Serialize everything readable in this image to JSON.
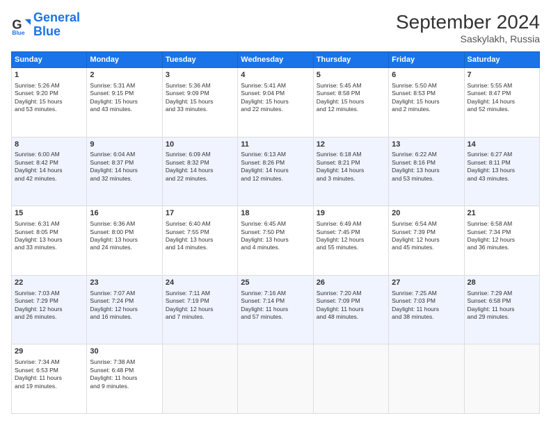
{
  "logo": {
    "line1": "General",
    "line2": "Blue"
  },
  "title": "September 2024",
  "subtitle": "Saskylakh, Russia",
  "headers": [
    "Sunday",
    "Monday",
    "Tuesday",
    "Wednesday",
    "Thursday",
    "Friday",
    "Saturday"
  ],
  "weeks": [
    [
      {
        "day": 1,
        "lines": [
          "Sunrise: 5:26 AM",
          "Sunset: 9:20 PM",
          "Daylight: 15 hours",
          "and 53 minutes."
        ]
      },
      {
        "day": 2,
        "lines": [
          "Sunrise: 5:31 AM",
          "Sunset: 9:15 PM",
          "Daylight: 15 hours",
          "and 43 minutes."
        ]
      },
      {
        "day": 3,
        "lines": [
          "Sunrise: 5:36 AM",
          "Sunset: 9:09 PM",
          "Daylight: 15 hours",
          "and 33 minutes."
        ]
      },
      {
        "day": 4,
        "lines": [
          "Sunrise: 5:41 AM",
          "Sunset: 9:04 PM",
          "Daylight: 15 hours",
          "and 22 minutes."
        ]
      },
      {
        "day": 5,
        "lines": [
          "Sunrise: 5:45 AM",
          "Sunset: 8:58 PM",
          "Daylight: 15 hours",
          "and 12 minutes."
        ]
      },
      {
        "day": 6,
        "lines": [
          "Sunrise: 5:50 AM",
          "Sunset: 8:53 PM",
          "Daylight: 15 hours",
          "and 2 minutes."
        ]
      },
      {
        "day": 7,
        "lines": [
          "Sunrise: 5:55 AM",
          "Sunset: 8:47 PM",
          "Daylight: 14 hours",
          "and 52 minutes."
        ]
      }
    ],
    [
      {
        "day": 8,
        "lines": [
          "Sunrise: 6:00 AM",
          "Sunset: 8:42 PM",
          "Daylight: 14 hours",
          "and 42 minutes."
        ]
      },
      {
        "day": 9,
        "lines": [
          "Sunrise: 6:04 AM",
          "Sunset: 8:37 PM",
          "Daylight: 14 hours",
          "and 32 minutes."
        ]
      },
      {
        "day": 10,
        "lines": [
          "Sunrise: 6:09 AM",
          "Sunset: 8:32 PM",
          "Daylight: 14 hours",
          "and 22 minutes."
        ]
      },
      {
        "day": 11,
        "lines": [
          "Sunrise: 6:13 AM",
          "Sunset: 8:26 PM",
          "Daylight: 14 hours",
          "and 12 minutes."
        ]
      },
      {
        "day": 12,
        "lines": [
          "Sunrise: 6:18 AM",
          "Sunset: 8:21 PM",
          "Daylight: 14 hours",
          "and 3 minutes."
        ]
      },
      {
        "day": 13,
        "lines": [
          "Sunrise: 6:22 AM",
          "Sunset: 8:16 PM",
          "Daylight: 13 hours",
          "and 53 minutes."
        ]
      },
      {
        "day": 14,
        "lines": [
          "Sunrise: 6:27 AM",
          "Sunset: 8:11 PM",
          "Daylight: 13 hours",
          "and 43 minutes."
        ]
      }
    ],
    [
      {
        "day": 15,
        "lines": [
          "Sunrise: 6:31 AM",
          "Sunset: 8:05 PM",
          "Daylight: 13 hours",
          "and 33 minutes."
        ]
      },
      {
        "day": 16,
        "lines": [
          "Sunrise: 6:36 AM",
          "Sunset: 8:00 PM",
          "Daylight: 13 hours",
          "and 24 minutes."
        ]
      },
      {
        "day": 17,
        "lines": [
          "Sunrise: 6:40 AM",
          "Sunset: 7:55 PM",
          "Daylight: 13 hours",
          "and 14 minutes."
        ]
      },
      {
        "day": 18,
        "lines": [
          "Sunrise: 6:45 AM",
          "Sunset: 7:50 PM",
          "Daylight: 13 hours",
          "and 4 minutes."
        ]
      },
      {
        "day": 19,
        "lines": [
          "Sunrise: 6:49 AM",
          "Sunset: 7:45 PM",
          "Daylight: 12 hours",
          "and 55 minutes."
        ]
      },
      {
        "day": 20,
        "lines": [
          "Sunrise: 6:54 AM",
          "Sunset: 7:39 PM",
          "Daylight: 12 hours",
          "and 45 minutes."
        ]
      },
      {
        "day": 21,
        "lines": [
          "Sunrise: 6:58 AM",
          "Sunset: 7:34 PM",
          "Daylight: 12 hours",
          "and 36 minutes."
        ]
      }
    ],
    [
      {
        "day": 22,
        "lines": [
          "Sunrise: 7:03 AM",
          "Sunset: 7:29 PM",
          "Daylight: 12 hours",
          "and 26 minutes."
        ]
      },
      {
        "day": 23,
        "lines": [
          "Sunrise: 7:07 AM",
          "Sunset: 7:24 PM",
          "Daylight: 12 hours",
          "and 16 minutes."
        ]
      },
      {
        "day": 24,
        "lines": [
          "Sunrise: 7:11 AM",
          "Sunset: 7:19 PM",
          "Daylight: 12 hours",
          "and 7 minutes."
        ]
      },
      {
        "day": 25,
        "lines": [
          "Sunrise: 7:16 AM",
          "Sunset: 7:14 PM",
          "Daylight: 11 hours",
          "and 57 minutes."
        ]
      },
      {
        "day": 26,
        "lines": [
          "Sunrise: 7:20 AM",
          "Sunset: 7:09 PM",
          "Daylight: 11 hours",
          "and 48 minutes."
        ]
      },
      {
        "day": 27,
        "lines": [
          "Sunrise: 7:25 AM",
          "Sunset: 7:03 PM",
          "Daylight: 11 hours",
          "and 38 minutes."
        ]
      },
      {
        "day": 28,
        "lines": [
          "Sunrise: 7:29 AM",
          "Sunset: 6:58 PM",
          "Daylight: 11 hours",
          "and 29 minutes."
        ]
      }
    ],
    [
      {
        "day": 29,
        "lines": [
          "Sunrise: 7:34 AM",
          "Sunset: 6:53 PM",
          "Daylight: 11 hours",
          "and 19 minutes."
        ]
      },
      {
        "day": 30,
        "lines": [
          "Sunrise: 7:38 AM",
          "Sunset: 6:48 PM",
          "Daylight: 11 hours",
          "and 9 minutes."
        ]
      },
      {
        "day": null,
        "lines": []
      },
      {
        "day": null,
        "lines": []
      },
      {
        "day": null,
        "lines": []
      },
      {
        "day": null,
        "lines": []
      },
      {
        "day": null,
        "lines": []
      }
    ]
  ]
}
